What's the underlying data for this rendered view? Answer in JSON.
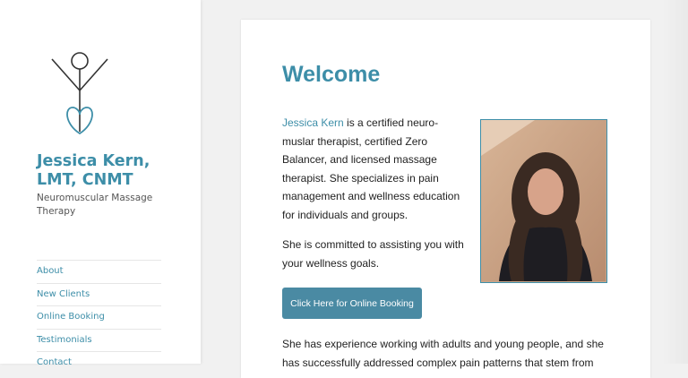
{
  "site": {
    "title": "Jessica Kern, LMT, CNMT",
    "description": "Neuromuscular Massage Therapy"
  },
  "nav": {
    "items": [
      {
        "label": "About"
      },
      {
        "label": "New Clients"
      },
      {
        "label": "Online Booking"
      },
      {
        "label": "Testimonials"
      },
      {
        "label": "Contact"
      }
    ]
  },
  "main": {
    "heading": "Welcome",
    "intro_link": "Jessica Kern",
    "intro_rest": " is a certified neuro-muslar therapist, certified Zero Balancer, and  licensed massage therapist.  She specializes in pain management and wellness education for individuals and groups.",
    "para2": "She is committed to assisting you with your wellness goals.",
    "booking_button": "Click Here for Online Booking",
    "para3": "She has experience working with adults and young people, and she has successfully addressed complex pain patterns that stem from"
  },
  "colors": {
    "accent": "#3d8ea8",
    "button": "#4a8aa3"
  }
}
